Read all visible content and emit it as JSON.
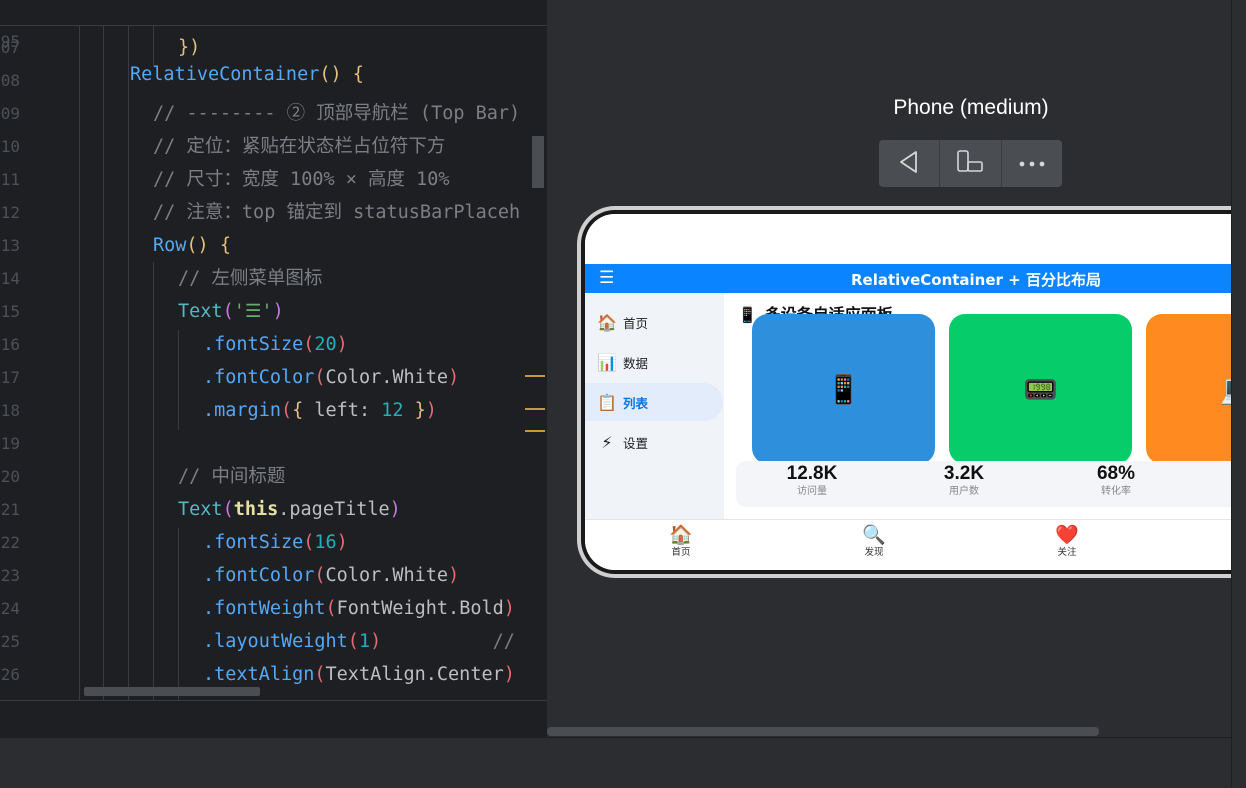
{
  "editor": {
    "sticky_line": {
      "num": "95",
      "code": [
        [
          "RelativeContainer",
          "c-fn"
        ],
        [
          "() ",
          "c-br"
        ],
        [
          "{",
          "c-br"
        ]
      ]
    },
    "lines": [
      {
        "num": "07",
        "code": [
          [
            "})",
            "c-br"
          ]
        ]
      },
      {
        "num": "08",
        "code": []
      },
      {
        "num": "09",
        "code": [
          [
            "// -------- ② 顶部导航栏 (Top Bar)",
            "c-cmt"
          ]
        ]
      },
      {
        "num": "10",
        "code": [
          [
            "// 定位：紧贴在状态栏占位符下方",
            "c-cmt"
          ]
        ]
      },
      {
        "num": "11",
        "code": [
          [
            "// 尺寸：宽度 100% × 高度 10%",
            "c-cmt"
          ]
        ]
      },
      {
        "num": "12",
        "code": [
          [
            "// 注意：top 锚定到 statusBarPlaceh",
            "c-cmt"
          ]
        ]
      },
      {
        "num": "13",
        "code": [
          [
            "Row",
            "c-fn"
          ],
          [
            "() ",
            "c-br"
          ],
          [
            "{",
            "c-br"
          ]
        ]
      },
      {
        "num": "14",
        "code": [
          [
            "// 左侧菜单图标",
            "c-cmt"
          ]
        ]
      },
      {
        "num": "15",
        "code": [
          [
            "Text",
            "c-type"
          ],
          [
            "(",
            "c-br2"
          ],
          [
            "'☰'",
            "c-str"
          ],
          [
            ")",
            "c-br2"
          ]
        ]
      },
      {
        "num": "16",
        "code": [
          [
            ".fontSize",
            "c-fn"
          ],
          [
            "(",
            "c-paren"
          ],
          [
            "20",
            "c-num"
          ],
          [
            ")",
            "c-paren"
          ]
        ]
      },
      {
        "num": "17",
        "code": [
          [
            ".fontColor",
            "c-fn"
          ],
          [
            "(",
            "c-paren"
          ],
          [
            "Color.White",
            "c-plain"
          ],
          [
            ")",
            "c-paren"
          ]
        ]
      },
      {
        "num": "18",
        "code": [
          [
            ".margin",
            "c-fn"
          ],
          [
            "(",
            "c-paren"
          ],
          [
            "{ ",
            "c-br"
          ],
          [
            "left",
            "c-plain"
          ],
          [
            ": ",
            "c-plain"
          ],
          [
            "12",
            "c-num"
          ],
          [
            " }",
            "c-br"
          ],
          [
            ")",
            "c-paren"
          ]
        ]
      },
      {
        "num": "19",
        "code": []
      },
      {
        "num": "20",
        "code": [
          [
            "// 中间标题",
            "c-cmt"
          ]
        ]
      },
      {
        "num": "21",
        "code": [
          [
            "Text",
            "c-type"
          ],
          [
            "(",
            "c-br2"
          ],
          [
            "this",
            "c-this"
          ],
          [
            ".pageTitle",
            "c-plain"
          ],
          [
            ")",
            "c-br2"
          ]
        ]
      },
      {
        "num": "22",
        "code": [
          [
            ".fontSize",
            "c-fn"
          ],
          [
            "(",
            "c-paren"
          ],
          [
            "16",
            "c-num"
          ],
          [
            ")",
            "c-paren"
          ]
        ]
      },
      {
        "num": "23",
        "code": [
          [
            ".fontColor",
            "c-fn"
          ],
          [
            "(",
            "c-paren"
          ],
          [
            "Color.White",
            "c-plain"
          ],
          [
            ")",
            "c-paren"
          ]
        ]
      },
      {
        "num": "24",
        "code": [
          [
            ".fontWeight",
            "c-fn"
          ],
          [
            "(",
            "c-paren"
          ],
          [
            "FontWeight.Bold",
            "c-plain"
          ],
          [
            ")",
            "c-paren"
          ]
        ]
      },
      {
        "num": "25",
        "code": [
          [
            ".layoutWeight",
            "c-fn"
          ],
          [
            "(",
            "c-paren"
          ],
          [
            "1",
            "c-num"
          ],
          [
            ")",
            "c-paren"
          ],
          [
            "          //",
            "c-cmt"
          ]
        ]
      },
      {
        "num": "26",
        "code": [
          [
            ".textAlign",
            "c-fn"
          ],
          [
            "(",
            "c-paren"
          ],
          [
            "TextAlign.Center",
            "c-plain"
          ],
          [
            ")",
            "c-paren"
          ]
        ]
      }
    ]
  },
  "preview": {
    "device_name": "Phone (medium)",
    "toolbar": {
      "back_icon": "back-triangle-icon",
      "rotate_icon": "device-rotate-icon",
      "more_icon": "more-dots-icon"
    }
  },
  "app": {
    "menu_glyph": "☰",
    "title": "RelativeContainer + 百分比布局",
    "sidebar": [
      {
        "icon": "🏠",
        "label": "首页"
      },
      {
        "icon": "📊",
        "label": "数据"
      },
      {
        "icon": "📋",
        "label": "列表",
        "active": true
      },
      {
        "icon": "⚡",
        "label": "设置"
      }
    ],
    "heading_icon": "📱",
    "heading": "多设备自适应面板",
    "cards": [
      {
        "color": "#2e90dc",
        "icon": "📱"
      },
      {
        "color": "#07cc6a",
        "icon": "📟"
      },
      {
        "color": "#ff8a1f",
        "icon": "💻"
      }
    ],
    "stats": [
      {
        "value": "12.8K",
        "label": "访问量"
      },
      {
        "value": "3.2K",
        "label": "用户数"
      },
      {
        "value": "68%",
        "label": "转化率"
      }
    ],
    "tabs": [
      {
        "icon": "🏠",
        "label": "首页"
      },
      {
        "icon": "🔍",
        "label": "发现"
      },
      {
        "icon": "❤️",
        "label": "关注"
      }
    ]
  }
}
